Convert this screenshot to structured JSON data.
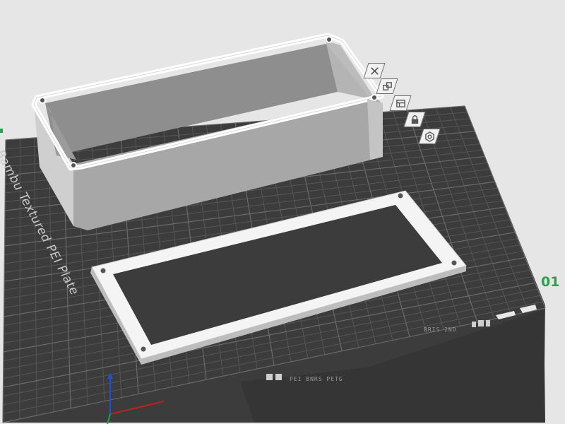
{
  "plate": {
    "label": "Bambu Textured PEI Plate",
    "number": "01",
    "bottom_text": "PEI BNRS PETG",
    "corner_text": "BRIS 2ND"
  },
  "toolbar": {
    "buttons": [
      {
        "name": "delete-plate-button",
        "icon": "close-icon"
      },
      {
        "name": "arrange-button",
        "icon": "arrange-icon"
      },
      {
        "name": "orient-button",
        "icon": "orient-icon"
      },
      {
        "name": "lock-plate-button",
        "icon": "lock-icon"
      },
      {
        "name": "plate-settings-button",
        "icon": "gear-icon"
      }
    ]
  },
  "colors": {
    "background": "#e6e6e6",
    "bed": "#3d3d3d",
    "grid": "#5a5a5a",
    "model": "#d3d3d3",
    "model_top": "#ffffff",
    "accent": "#19a84a"
  }
}
